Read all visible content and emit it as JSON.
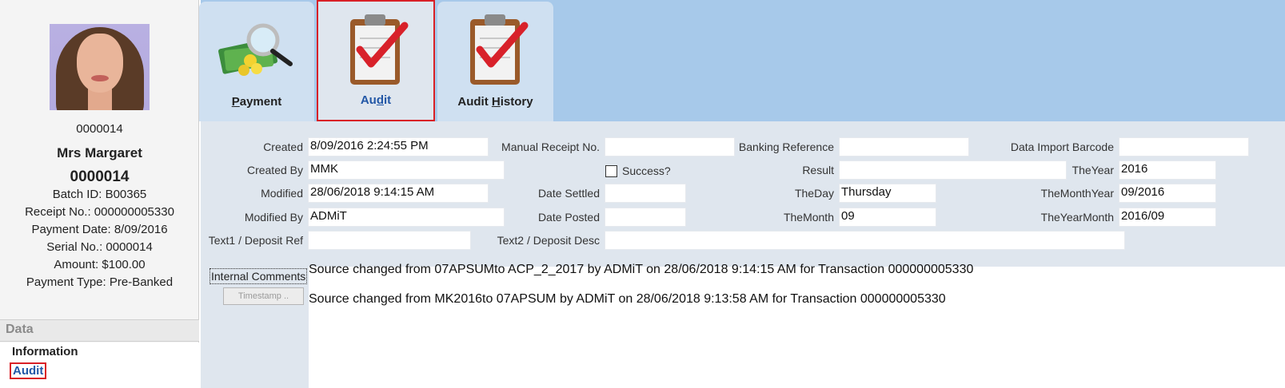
{
  "profile": {
    "number": "0000014",
    "name": "Mrs Margaret",
    "id": "0000014",
    "batch": "Batch ID: B00365",
    "receipt": "Receipt No.: 000000005330",
    "payment_date": "Payment Date: 8/09/2016",
    "serial": "Serial No.: 0000014",
    "amount": "Amount: $100.00",
    "payment_type": "Payment Type: Pre-Banked"
  },
  "sidebar": {
    "section_title": "Data",
    "items": [
      {
        "label": "Information"
      },
      {
        "label": "Audit"
      }
    ]
  },
  "tabs": [
    {
      "label_pre": "",
      "label_u": "P",
      "label_post": "ayment",
      "icon": "money-magnifier-icon"
    },
    {
      "label_pre": "Au",
      "label_u": "d",
      "label_post": "it",
      "icon": "clipboard-check-icon"
    },
    {
      "label_pre": "Audit ",
      "label_u": "H",
      "label_post": "istory",
      "icon": "clipboard-check-icon"
    }
  ],
  "form": {
    "created": {
      "label": "Created",
      "value": "8/09/2016 2:24:55 PM"
    },
    "created_by": {
      "label": "Created By",
      "value": "MMK"
    },
    "modified": {
      "label": "Modified",
      "value": "28/06/2018 9:14:15 AM"
    },
    "modified_by": {
      "label": "Modified By",
      "value": "ADMiT"
    },
    "text1": {
      "label": "Text1 / Deposit Ref",
      "value": ""
    },
    "manual_receipt": {
      "label": "Manual Receipt No.",
      "value": ""
    },
    "success": {
      "label": "Success?"
    },
    "date_settled": {
      "label": "Date Settled",
      "value": ""
    },
    "date_posted": {
      "label": "Date Posted",
      "value": ""
    },
    "text2": {
      "label": "Text2 / Deposit Desc",
      "value": ""
    },
    "banking_reference": {
      "label": "Banking Reference",
      "value": ""
    },
    "result": {
      "label": "Result",
      "value": ""
    },
    "the_day": {
      "label": "TheDay",
      "value": "Thursday"
    },
    "the_month": {
      "label": "TheMonth",
      "value": "09"
    },
    "data_import_barcode": {
      "label": "Data Import Barcode",
      "value": ""
    },
    "the_year": {
      "label": "TheYear",
      "value": "2016"
    },
    "the_month_year": {
      "label": "TheMonthYear",
      "value": "09/2016"
    },
    "the_year_month": {
      "label": "TheYearMonth",
      "value": "2016/09"
    }
  },
  "comments": {
    "label": "Internal Comments",
    "timestamp_button": "Timestamp",
    "lines": [
      "Source changed from 07APSUMto ACP_2_2017 by ADMiT on 28/06/2018 9:14:15 AM for Transaction 000000005330",
      "Source changed from MK2016to 07APSUM by ADMiT on 28/06/2018 9:13:58 AM for Transaction 000000005330"
    ]
  },
  "colors": {
    "accent_blue": "#2257a6",
    "highlight_red": "#d92026",
    "tabbar": "#a7c9ea"
  }
}
